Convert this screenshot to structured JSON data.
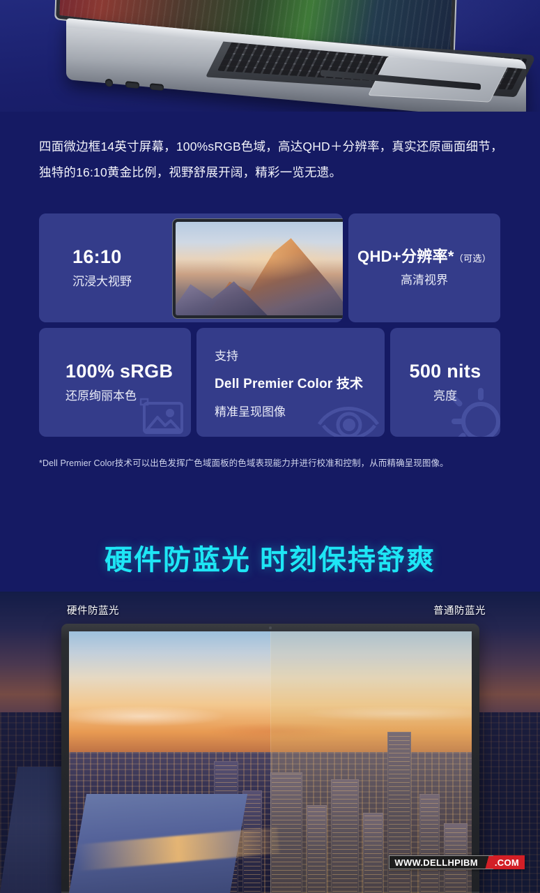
{
  "hero": {
    "alt": "dell-laptop-side-view-photo"
  },
  "intro": {
    "paragraph": "四面微边框14英寸屏幕，100%sRGB色域，高达QHD＋分辨率，真实还原画面细节，独特的16:10黄金比例，视野舒展开阔，精彩一览无遗。"
  },
  "features": {
    "ratio": {
      "title": "16:10",
      "subtitle": "沉浸大视野",
      "image_alt": "mountain-sunrise-on-screen"
    },
    "qhd": {
      "title": "QHD+分辨率*",
      "paren": "（可选）",
      "subtitle": "高清视界"
    },
    "srgb": {
      "title": "100% sRGB",
      "subtitle": "还原绚丽本色",
      "icon": "picture-icon"
    },
    "premier_color": {
      "line1": "支持",
      "line2": "Dell Premier Color 技术",
      "line3": "精准呈现图像",
      "icon": "eye-icon"
    },
    "nits": {
      "title": "500 nits",
      "subtitle": "亮度",
      "icon": "brightness-icon"
    }
  },
  "footnote": {
    "text": "*Dell Premier Color技术可以出色发挥广色域面板的色域表现能力并进行校准和控制，从而精确呈现图像。"
  },
  "bluelight": {
    "headline": "硬件防蓝光 时刻保持舒爽",
    "label_left": "硬件防蓝光",
    "label_right": "普通防蓝光",
    "image_alt": "new-york-city-skyline-sunset-split-comparison"
  },
  "watermark": {
    "domain": "WWW.DELLHPIBM",
    "tld": ".COM"
  },
  "colors": {
    "background": "#151a63",
    "card": "#343c8a",
    "headline_cyan": "#1ee6f5",
    "text_white": "#ffffff",
    "footnote_text": "#cfd4ec",
    "watermark_red": "#d31f26"
  }
}
